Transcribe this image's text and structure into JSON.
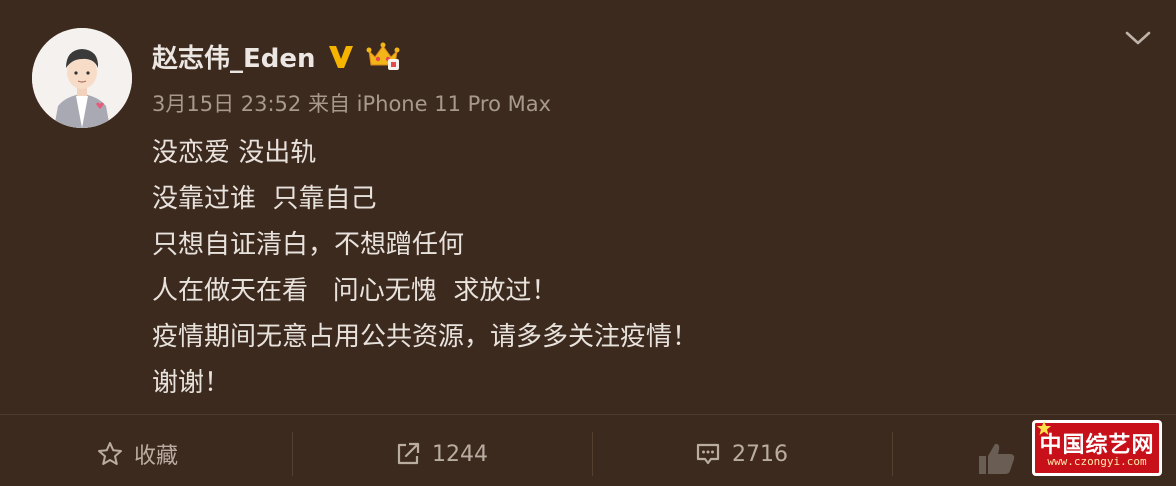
{
  "post": {
    "username": "赵志伟_Eden",
    "timestamp": "3月15日 23:52",
    "source": "来自 iPhone 11 Pro Max",
    "content_lines": [
      "没恋爱 没出轨",
      "没靠过谁  只靠自己",
      "只想自证清白，不想蹭任何",
      "人在做天在看   问心无愧  求放过！",
      "疫情期间无意占用公共资源，请多多关注疫情！",
      "谢谢！"
    ]
  },
  "badges": {
    "verified": "verified-v-icon",
    "crown": "member-crown-icon"
  },
  "actions": {
    "favorite_label": "收藏",
    "repost_count": "1244",
    "comment_count": "2716"
  },
  "watermark": {
    "title": "中国综艺网",
    "url": "www.czongyi.com"
  },
  "colors": {
    "background": "#3d2a1f",
    "text": "#e8e2dc",
    "meta": "#a7998e",
    "verified": "#f6b300",
    "watermark": "#c8101a"
  }
}
